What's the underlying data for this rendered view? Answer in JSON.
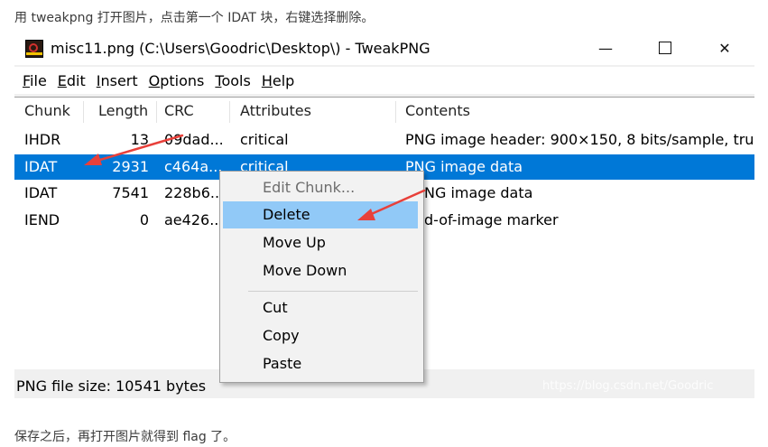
{
  "captions": {
    "top": "用 tweakpng 打开图片，点击第一个 IDAT 块，右键选择删除。",
    "bottom": "保存之后，再打开图片就得到 flag 了。"
  },
  "window": {
    "title": "misc11.png (C:\\Users\\Goodric\\Desktop\\) - TweakPNG",
    "icon": "tweakpng-app-icon",
    "controls": {
      "minimize": "—",
      "maximize": "☐",
      "close": "✕"
    }
  },
  "menu": [
    {
      "key": "F",
      "rest": "ile"
    },
    {
      "key": "E",
      "rest": "dit"
    },
    {
      "key": "I",
      "rest": "nsert"
    },
    {
      "key": "O",
      "rest": "ptions"
    },
    {
      "key": "T",
      "rest": "ools"
    },
    {
      "key": "H",
      "rest": "elp"
    }
  ],
  "columns": [
    "Chunk",
    "Length",
    "CRC",
    "Attributes",
    "Contents"
  ],
  "rows": [
    {
      "chunk": "IHDR",
      "length": "13",
      "crc": "09dad...",
      "attributes": "critical",
      "contents": "PNG image header: 900×150, 8 bits/sample, tru"
    },
    {
      "chunk": "IDAT",
      "length": "2931",
      "crc": "c464a...",
      "attributes": "critical",
      "contents": "PNG image data",
      "selected": true
    },
    {
      "chunk": "IDAT",
      "length": "7541",
      "crc": "228b6...",
      "attributes": "",
      "contents": "NG image data"
    },
    {
      "chunk": "IEND",
      "length": "0",
      "crc": "ae426...",
      "attributes": "",
      "contents": "d-of-image marker"
    }
  ],
  "scrollbar": {
    "left_arrow": "<",
    "right_arrow": ">"
  },
  "status": "PNG file size: 10541 bytes",
  "watermark": "https://blog.csdn.net/Goodric",
  "context_menu": {
    "edit_chunk": "Edit Chunk...",
    "delete": "Delete",
    "move_up": "Move Up",
    "move_down": "Move Down",
    "cut": "Cut",
    "copy": "Copy",
    "paste": "Paste"
  },
  "colors": {
    "selection": "#0078d7",
    "menu_highlight": "#91c9f7",
    "annotation_arrow": "#e8403a"
  }
}
